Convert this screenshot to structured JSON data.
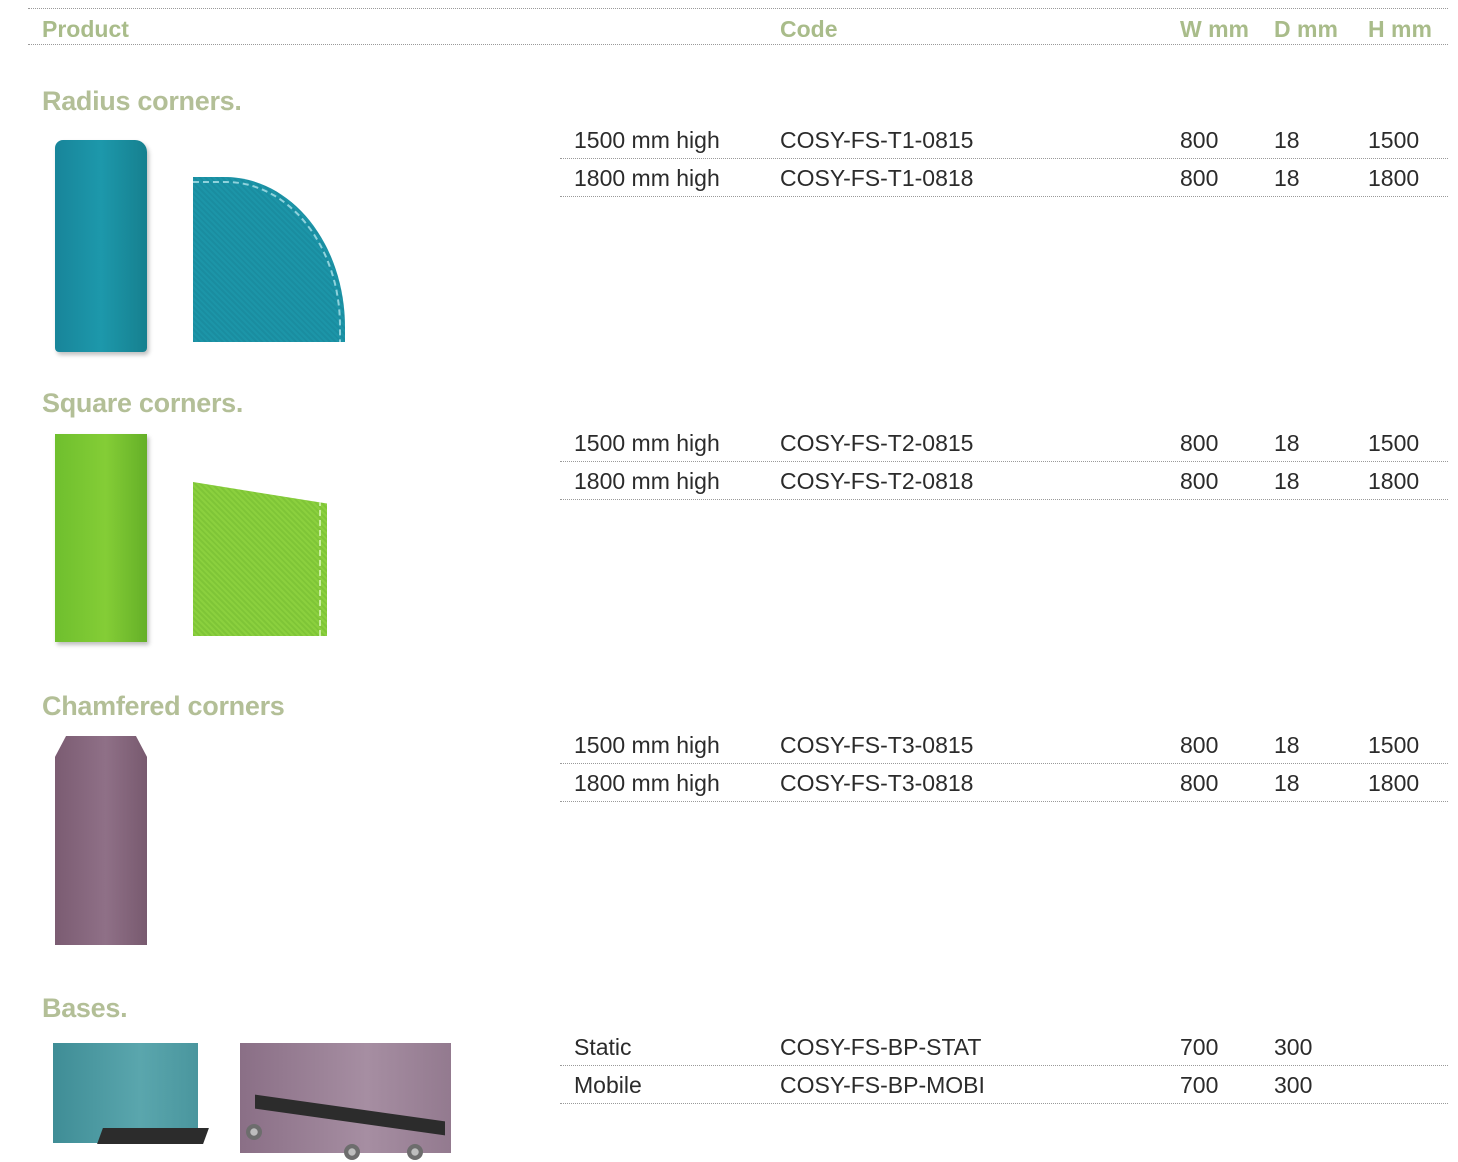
{
  "header": {
    "product": "Product",
    "code": "Code",
    "w": "W mm",
    "d": "D mm",
    "h": "H mm"
  },
  "sections": [
    {
      "title": "Radius corners.",
      "rows": [
        {
          "product": "1500 mm high",
          "code": "COSY-FS-T1-0815",
          "w": "800",
          "d": "18",
          "h": "1500"
        },
        {
          "product": "1800 mm high",
          "code": "COSY-FS-T1-0818",
          "w": "800",
          "d": "18",
          "h": "1800"
        }
      ]
    },
    {
      "title": "Square corners.",
      "rows": [
        {
          "product": "1500 mm high",
          "code": "COSY-FS-T2-0815",
          "w": "800",
          "d": "18",
          "h": "1500"
        },
        {
          "product": "1800 mm high",
          "code": "COSY-FS-T2-0818",
          "w": "800",
          "d": "18",
          "h": "1800"
        }
      ]
    },
    {
      "title": "Chamfered corners",
      "rows": [
        {
          "product": "1500 mm high",
          "code": "COSY-FS-T3-0815",
          "w": "800",
          "d": "18",
          "h": "1500"
        },
        {
          "product": "1800 mm high",
          "code": "COSY-FS-T3-0818",
          "w": "800",
          "d": "18",
          "h": "1800"
        }
      ]
    },
    {
      "title": "Bases.",
      "rows": [
        {
          "product": "Static",
          "code": "COSY-FS-BP-STAT",
          "w": "700",
          "d": "300",
          "h": ""
        },
        {
          "product": "Mobile",
          "code": "COSY-FS-BP-MOBI",
          "w": "700",
          "d": "300",
          "h": ""
        }
      ]
    }
  ],
  "colors": {
    "header_text": "#a9bc8a",
    "section_title": "#b3bf97",
    "body_text": "#2b2b2b"
  }
}
